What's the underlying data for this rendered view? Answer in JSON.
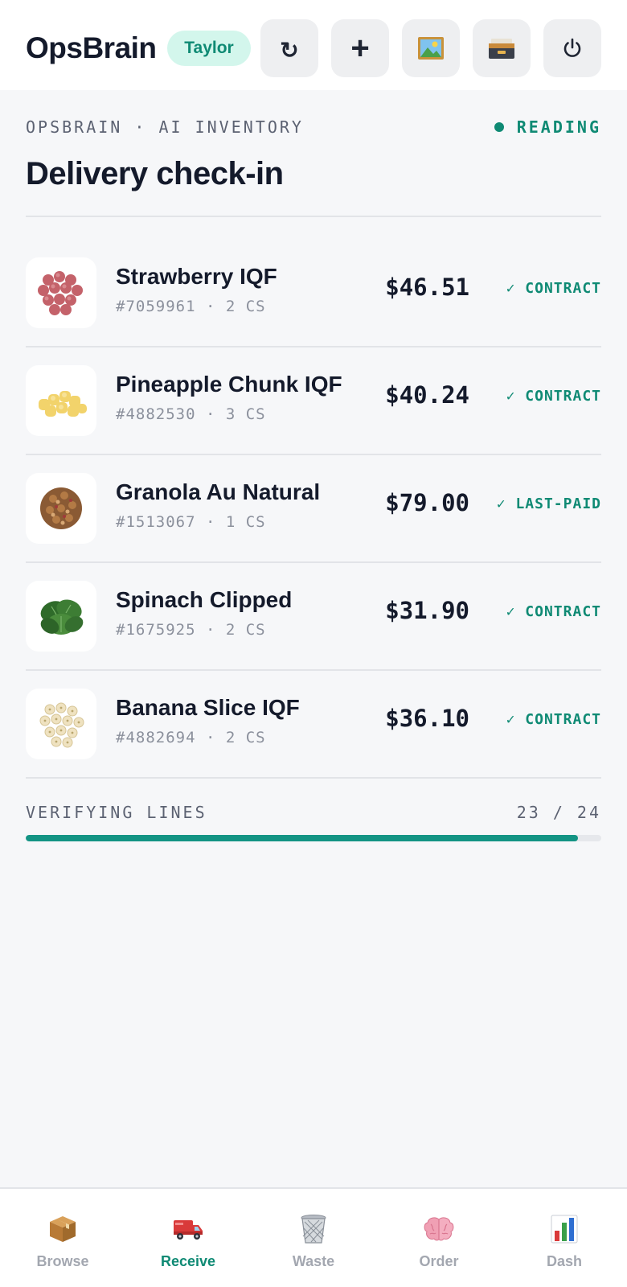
{
  "header": {
    "brand": "OpsBrain",
    "user": "Taylor",
    "buttons": [
      {
        "name": "refresh",
        "icon": "refresh-icon",
        "glyph": "↻"
      },
      {
        "name": "add",
        "icon": "plus-icon",
        "glyph": "+"
      },
      {
        "name": "image",
        "icon": "picture-icon"
      },
      {
        "name": "archive",
        "icon": "card-file-box-icon"
      },
      {
        "name": "power",
        "icon": "power-icon"
      }
    ]
  },
  "main": {
    "eyebrow": "OPSBRAIN · AI INVENTORY",
    "status": "READING",
    "title": "Delivery check-in"
  },
  "items": [
    {
      "name": "Strawberry IQF",
      "meta": "#7059961 · 2 CS",
      "price": "$46.51",
      "tag": "✓ CONTRACT",
      "icon": "strawberry-icon"
    },
    {
      "name": "Pineapple Chunk IQF",
      "meta": "#4882530 · 3 CS",
      "price": "$40.24",
      "tag": "✓ CONTRACT",
      "icon": "pineapple-chunk-icon"
    },
    {
      "name": "Granola Au Natural",
      "meta": "#1513067 · 1 CS",
      "price": "$79.00",
      "tag": "✓ LAST-PAID",
      "icon": "granola-icon"
    },
    {
      "name": "Spinach Clipped",
      "meta": "#1675925 · 2 CS",
      "price": "$31.90",
      "tag": "✓ CONTRACT",
      "icon": "spinach-icon"
    },
    {
      "name": "Banana Slice IQF",
      "meta": "#4882694 · 2 CS",
      "price": "$36.10",
      "tag": "✓ CONTRACT",
      "icon": "banana-slice-icon"
    }
  ],
  "progress": {
    "label": "VERIFYING LINES",
    "count": "23 / 24",
    "fraction": 0.96
  },
  "tabs": [
    {
      "label": "Browse",
      "icon": "package-icon",
      "active": false
    },
    {
      "label": "Receive",
      "icon": "delivery-truck-icon",
      "active": true
    },
    {
      "label": "Waste",
      "icon": "wastebasket-icon",
      "active": false
    },
    {
      "label": "Order",
      "icon": "brain-icon",
      "active": false
    },
    {
      "label": "Dash",
      "icon": "bar-chart-icon",
      "active": false
    }
  ],
  "colors": {
    "accent": "#0f8a74",
    "pill_bg": "#d3f6ec",
    "progress": "#139484",
    "text": "#141a2b",
    "muted": "#8b909c"
  }
}
